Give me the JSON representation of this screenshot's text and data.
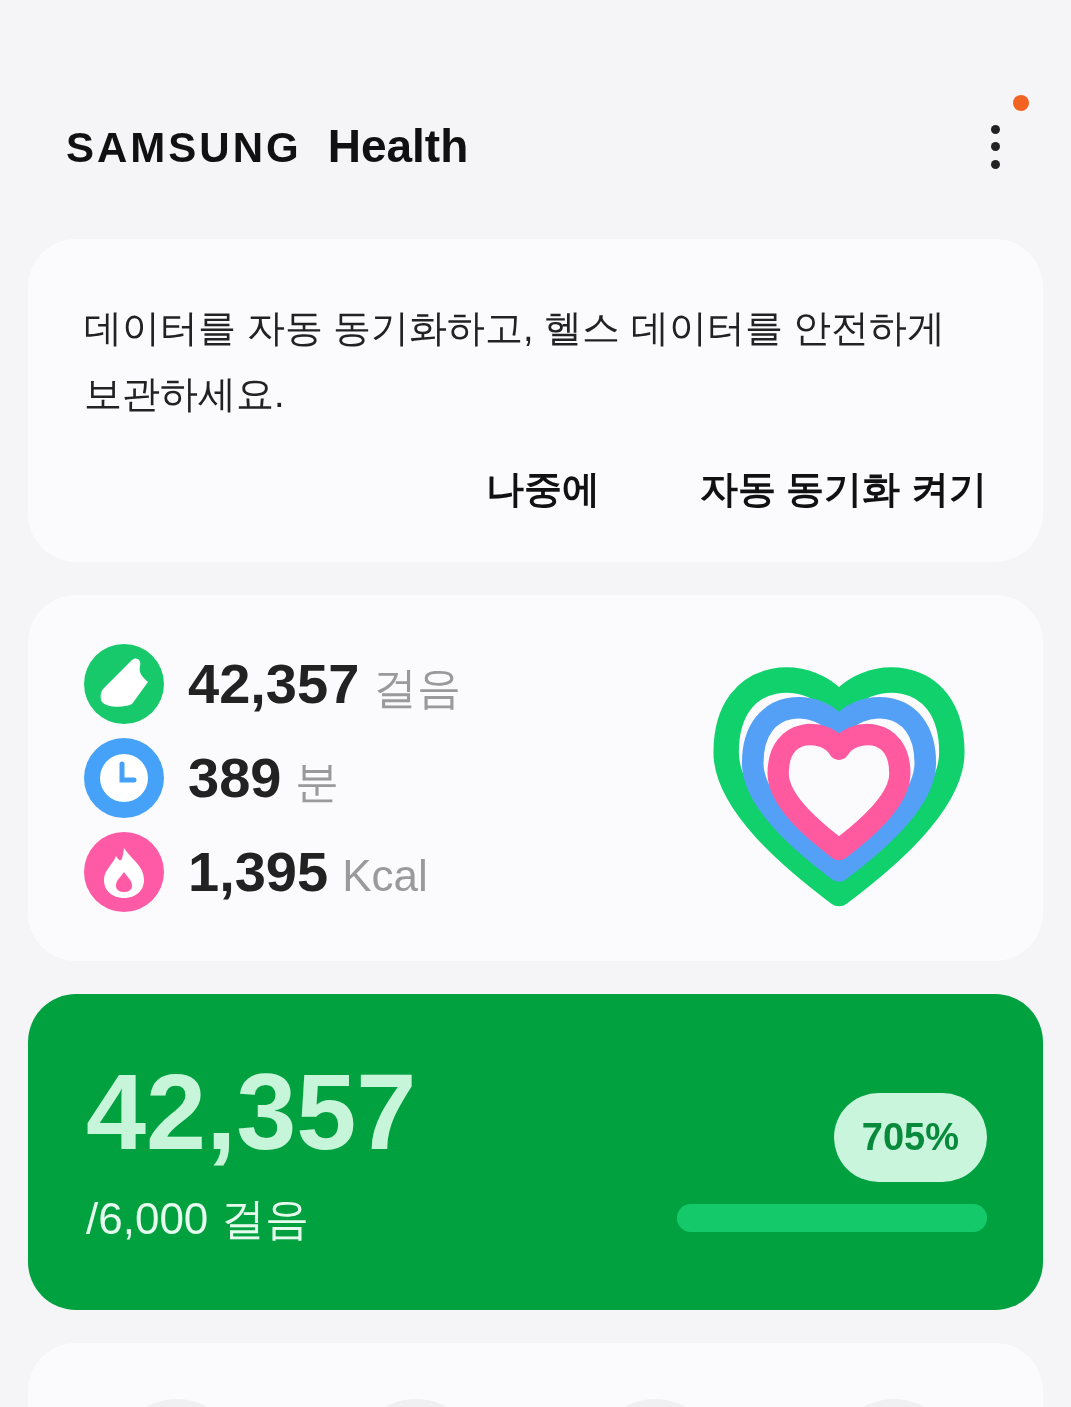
{
  "header": {
    "brand": "SAMSUNG",
    "product": "Health",
    "menu_notification": true
  },
  "sync_banner": {
    "message": "데이터를 자동 동기화하고, 헬스 데이터를 안전하게 보관하세요.",
    "buttons": [
      "나중에",
      "자동 동기화 켜기"
    ]
  },
  "activity": {
    "metrics": [
      {
        "kind": "steps",
        "color": "#17c96b",
        "value": "42,357",
        "unit": "걸음"
      },
      {
        "kind": "time",
        "color": "#45a2f8",
        "value": "389",
        "unit": "분"
      },
      {
        "kind": "calories",
        "color": "#ff5aa6",
        "value": "1,395",
        "unit": "Kcal"
      }
    ]
  },
  "steps_card": {
    "count": "42,357",
    "goal": "/6,000 걸음",
    "percent": "705%",
    "level": 1
  }
}
